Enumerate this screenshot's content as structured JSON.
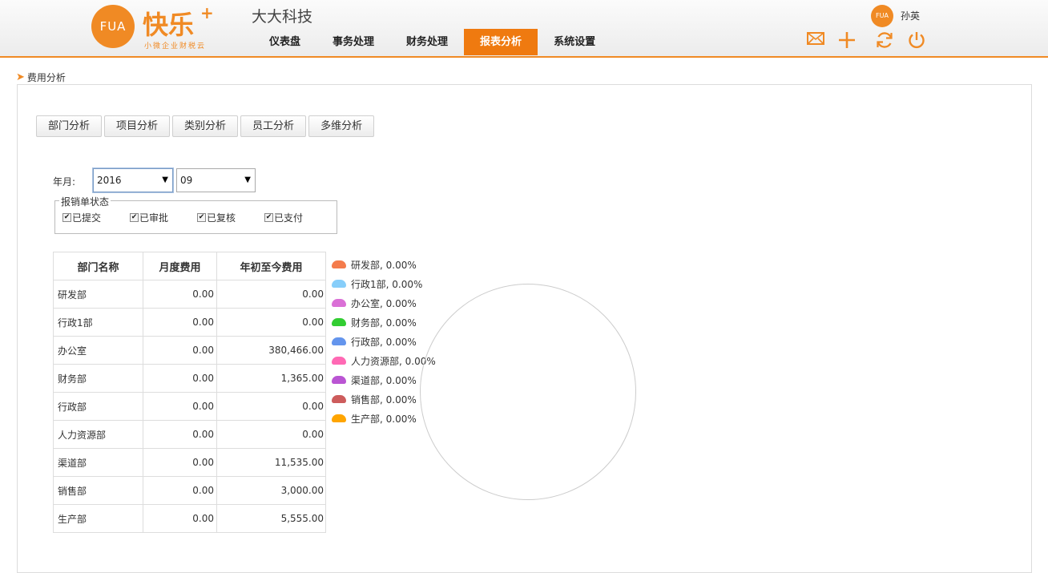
{
  "header": {
    "logo_text": "FUA",
    "brand": "快乐",
    "brand_plus": "+",
    "brand_sub": "小微企业财税云",
    "company": "大大科技",
    "nav": [
      {
        "label": "仪表盘",
        "active": false
      },
      {
        "label": "事务处理",
        "active": false
      },
      {
        "label": "财务处理",
        "active": false
      },
      {
        "label": "报表分析",
        "active": true
      },
      {
        "label": "系统设置",
        "active": false
      }
    ],
    "user": {
      "avatar_text": "FUA",
      "name": "孙英"
    },
    "tools": [
      "mail-icon",
      "plus-icon",
      "refresh-icon",
      "power-icon"
    ],
    "accent": "#f08a24"
  },
  "breadcrumb": {
    "title": "费用分析"
  },
  "tabs": [
    "部门分析",
    "项目分析",
    "类别分析",
    "员工分析",
    "多维分析"
  ],
  "filters": {
    "ym_label": "年月:",
    "year": "2016",
    "month": "09",
    "status_legend": "报销单状态",
    "statuses": [
      {
        "label": "已提交",
        "checked": true
      },
      {
        "label": "已审批",
        "checked": true
      },
      {
        "label": "已复核",
        "checked": true
      },
      {
        "label": "已支付",
        "checked": true
      }
    ]
  },
  "table": {
    "headers": [
      "部门名称",
      "月度费用",
      "年初至今费用"
    ],
    "rows": [
      [
        "研发部",
        "0.00",
        "0.00"
      ],
      [
        "行政1部",
        "0.00",
        "0.00"
      ],
      [
        "办公室",
        "0.00",
        "380,466.00"
      ],
      [
        "财务部",
        "0.00",
        "1,365.00"
      ],
      [
        "行政部",
        "0.00",
        "0.00"
      ],
      [
        "人力资源部",
        "0.00",
        "0.00"
      ],
      [
        "渠道部",
        "0.00",
        "11,535.00"
      ],
      [
        "销售部",
        "0.00",
        "3,000.00"
      ],
      [
        "生产部",
        "0.00",
        "5,555.00"
      ]
    ]
  },
  "chart_data": {
    "type": "pie",
    "title": "",
    "legend_position": "left",
    "slices": [
      {
        "label": "研发部, 0.00%",
        "value": 0,
        "color": "#f47c4c"
      },
      {
        "label": "行政1部, 0.00%",
        "value": 0,
        "color": "#87cefa"
      },
      {
        "label": "办公室, 0.00%",
        "value": 0,
        "color": "#da70d6"
      },
      {
        "label": "财务部, 0.00%",
        "value": 0,
        "color": "#32cd32"
      },
      {
        "label": "行政部, 0.00%",
        "value": 0,
        "color": "#6495ed"
      },
      {
        "label": "人力资源部, 0.00%",
        "value": 0,
        "color": "#ff69b4"
      },
      {
        "label": "渠道部, 0.00%",
        "value": 0,
        "color": "#ba55d3"
      },
      {
        "label": "销售部, 0.00%",
        "value": 0,
        "color": "#cd5c5c"
      },
      {
        "label": "生产部, 0.00%",
        "value": 0,
        "color": "#ffa500"
      }
    ]
  }
}
